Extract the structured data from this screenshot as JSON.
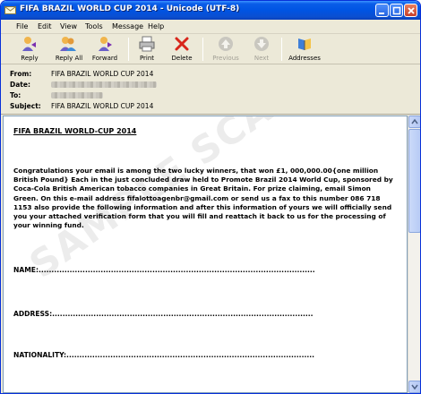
{
  "window": {
    "title": "FIFA BRAZIL WORLD CUP 2014 - Unicode (UTF-8)"
  },
  "menu": [
    "File",
    "Edit",
    "View",
    "Tools",
    "Message",
    "Help"
  ],
  "toolbar": {
    "reply": "Reply",
    "reply_all": "Reply All",
    "forward": "Forward",
    "print": "Print",
    "delete": "Delete",
    "previous": "Previous",
    "next": "Next",
    "addresses": "Addresses"
  },
  "headers": {
    "from_label": "From:",
    "from_value": "FIFA BRAZIL WORLD CUP 2014",
    "date_label": "Date:",
    "to_label": "To:",
    "subject_label": "Subject:",
    "subject_value": "FIFA BRAZIL WORLD CUP 2014"
  },
  "message": {
    "heading": "FIFA BRAZIL WORLD-CUP 2014",
    "paragraph": "Congratulations your email is among the two lucky winners, that won £1, 000,000.00{one million British Pound} Each in the just concluded draw held to Promote Brazil 2014 World Cup, sponsored by Coca-Cola British American tobacco companies in Great Britain. For prize claiming, email Simon Green. On this e-mail address fifalottoagenbr@gmail.com or send us a fax to this number 086 718 1153 also provide the following information and after this information of yours we will officially send you your attached verification form that you will fill and reattach it back to us for the processing of your winning fund.",
    "name_field": "NAME:...........................................................................................................",
    "address_field": "ADDRESS:.....................................................................................................",
    "nationality_field": "NATIONALITY:................................................................................................"
  },
  "watermark": "SAMPLE SCAM EMAIL",
  "colors": {
    "title_bar": "#0054e3",
    "window_bg": "#ece9d8",
    "delete_red": "#d8261b"
  }
}
